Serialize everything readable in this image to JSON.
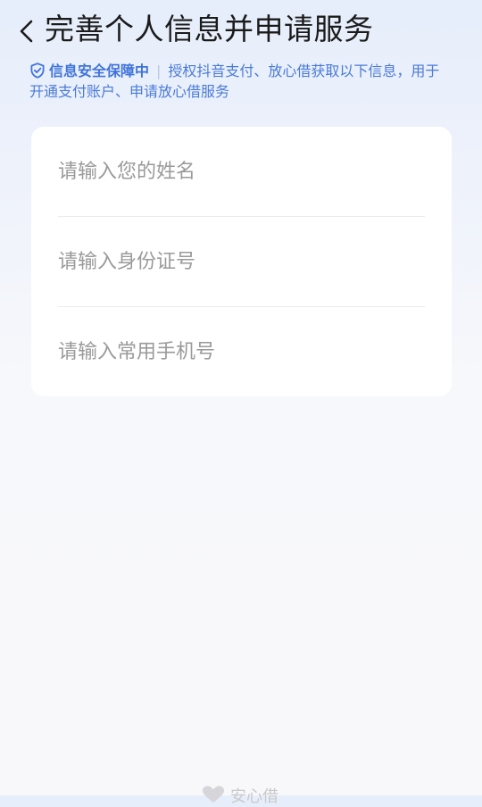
{
  "header": {
    "title": "完善个人信息并申请服务"
  },
  "notice": {
    "secure_label": "信息安全保障中",
    "separator": "|",
    "text": "授权抖音支付、放心借获取以下信息，用于开通支付账户、申请放心借服务"
  },
  "form": {
    "name_placeholder": "请输入您的姓名",
    "id_placeholder": "请输入身份证号",
    "phone_placeholder": "请输入常用手机号"
  },
  "footer": {
    "brand": "安心借"
  },
  "colors": {
    "accent": "#3f74db",
    "placeholder": "#9a9a9a",
    "title": "#1b1b1b"
  }
}
